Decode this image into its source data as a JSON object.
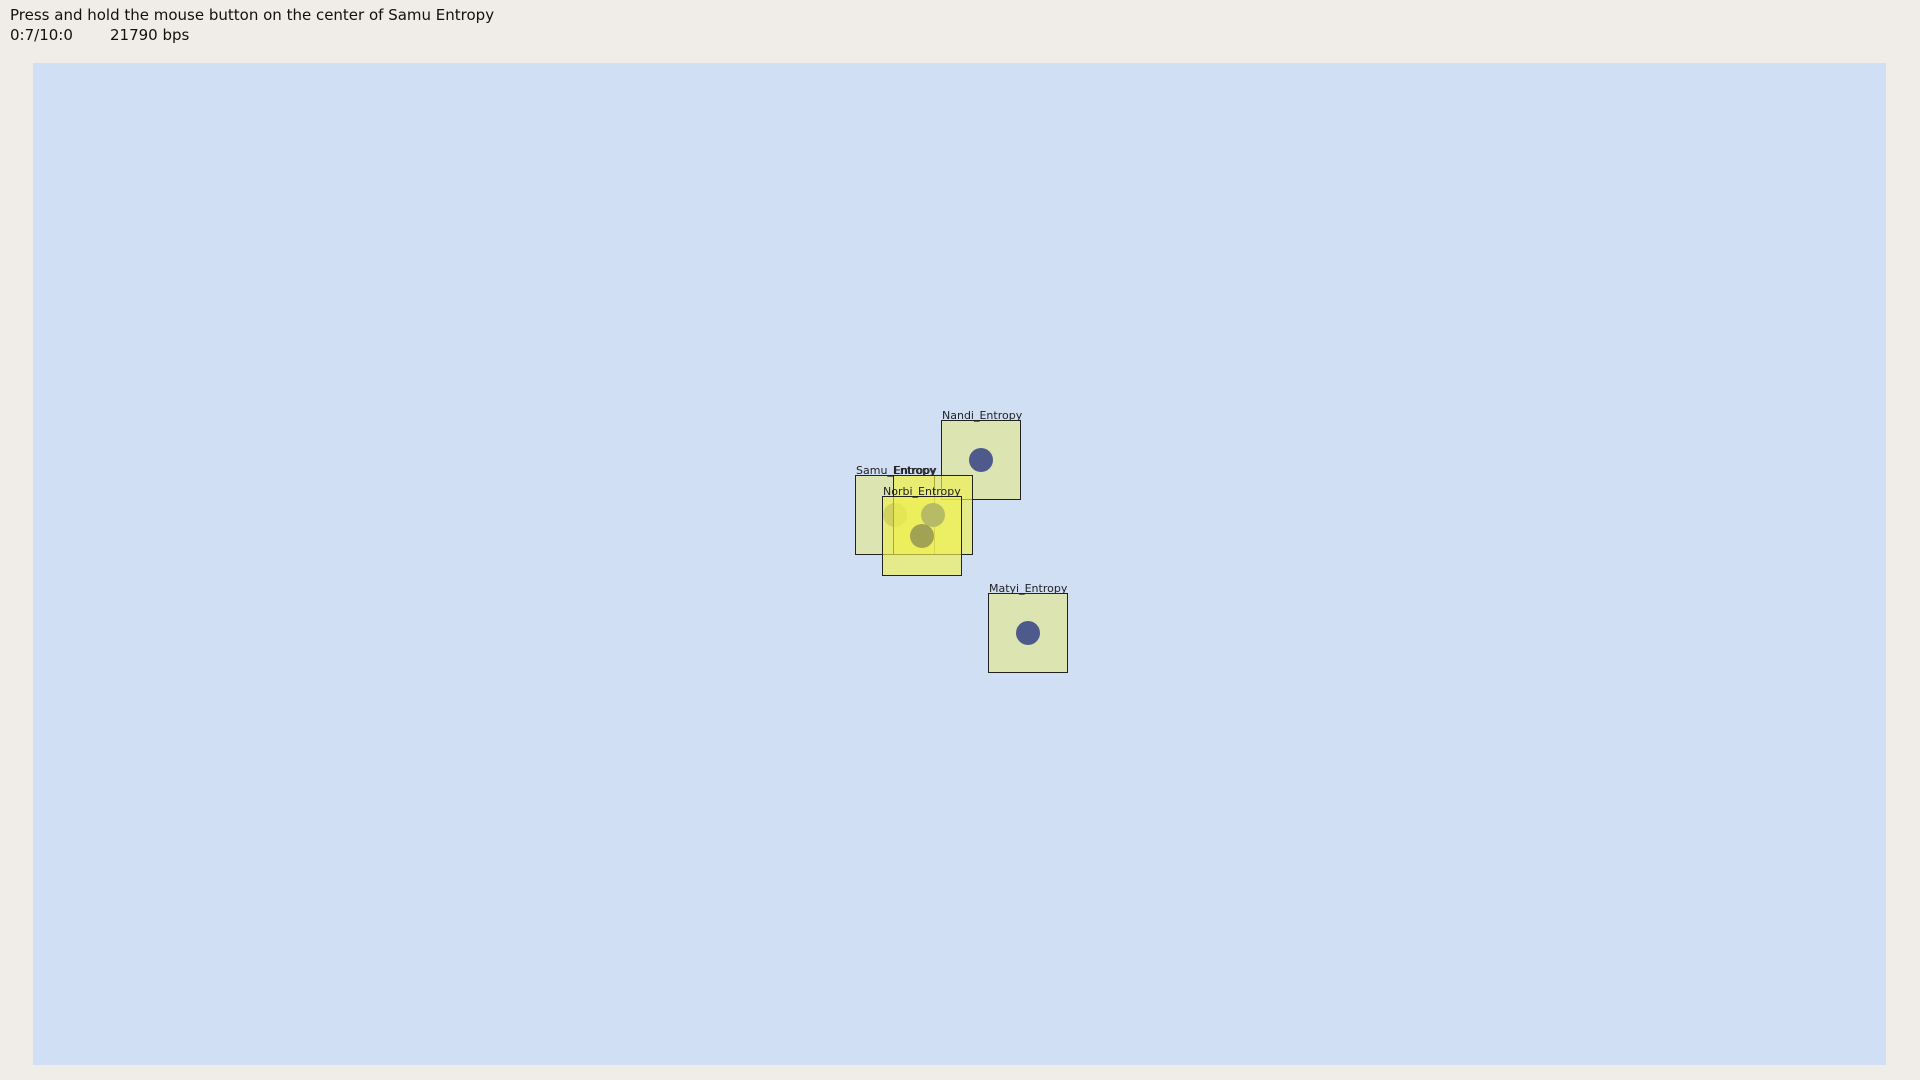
{
  "header": {
    "instruction": "Press and hold the mouse button on the center of Samu Entropy",
    "progress": "0:7/10:0",
    "rate": "21790 bps"
  },
  "targets": [
    {
      "label": "Samu_Entropy",
      "state": "dim",
      "dot": "muted"
    },
    {
      "label": "Nandi_Entropy",
      "state": "dim",
      "dot": "dark"
    },
    {
      "label": "Entropy",
      "state": "lit",
      "dot": "dark"
    },
    {
      "label": "Norbi_Entropy",
      "state": "lit",
      "dot": "muted"
    },
    {
      "label": "Matyi_Entropy",
      "state": "dim",
      "dot": "dark"
    }
  ],
  "colors": {
    "background": "#f0ede8",
    "canvas": "#d1dff5",
    "target_fill": "#e6ea78",
    "dot": "#4f5a8c"
  }
}
